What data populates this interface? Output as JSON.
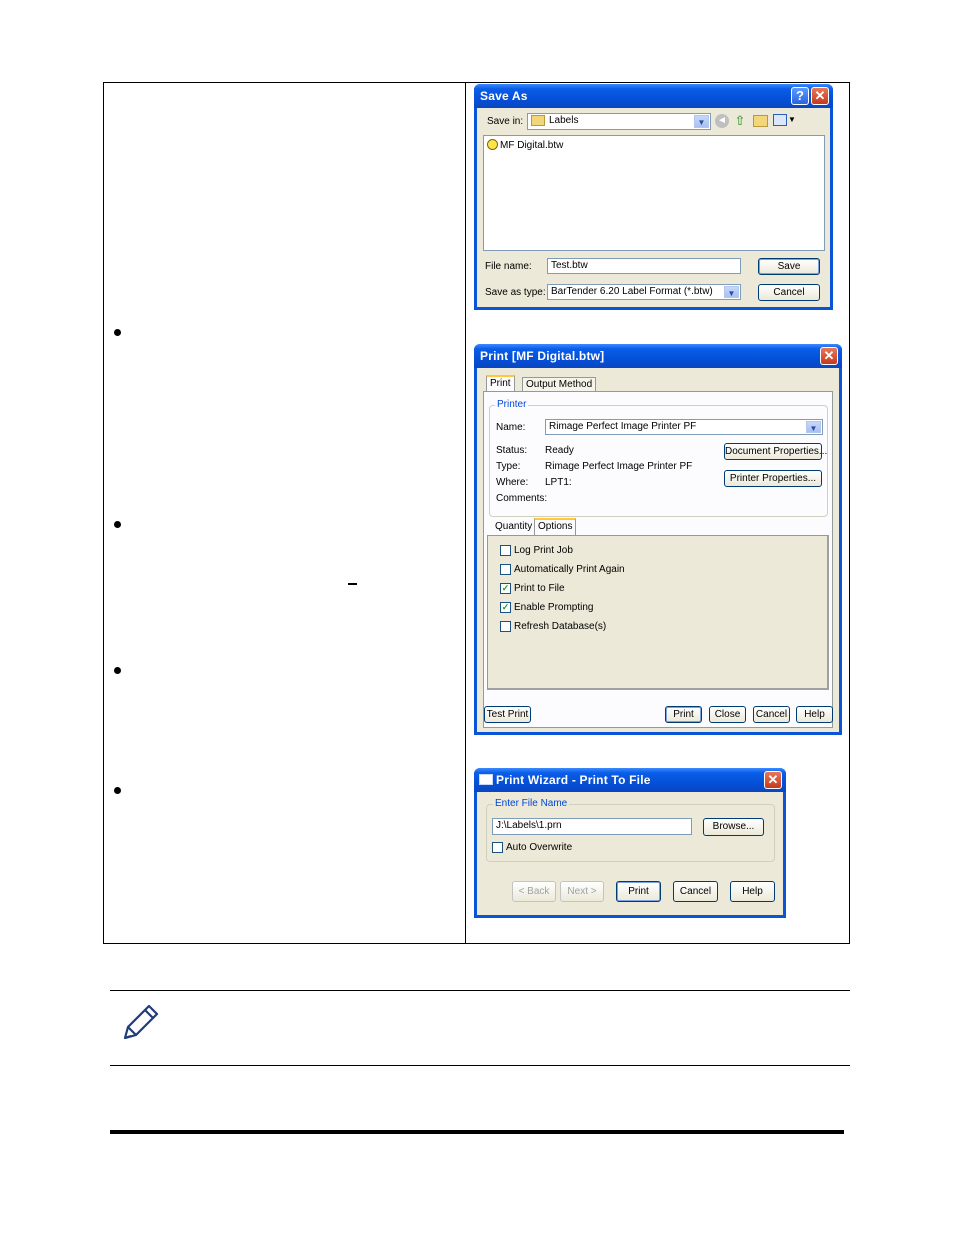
{
  "save_as": {
    "title": "Save As",
    "save_in_label": "Save in:",
    "save_in_value": "Labels",
    "file": "MF Digital.btw",
    "file_name_label": "File name:",
    "file_name_value": "Test.btw",
    "save_type_label": "Save as type:",
    "save_type_value": "BarTender 6.20 Label Format (*.btw)",
    "save_button": "Save",
    "cancel_button": "Cancel"
  },
  "print_dialog": {
    "title": "Print [MF Digital.btw]",
    "tabs": [
      "Print",
      "Output Method"
    ],
    "printer_group": "Printer",
    "name_label": "Name:",
    "name_value": "Rimage Perfect Image Printer PF",
    "status_label": "Status:",
    "status_value": "Ready",
    "type_label": "Type:",
    "type_value": "Rimage Perfect Image Printer PF",
    "where_label": "Where:",
    "where_value": "LPT1:",
    "comments_label": "Comments:",
    "doc_props_button": "Document Properties...",
    "printer_props_button": "Printer Properties...",
    "subtabs": [
      "Quantity",
      "Options"
    ],
    "options": [
      {
        "label": "Log Print Job",
        "checked": false
      },
      {
        "label": "Automatically Print Again",
        "checked": false
      },
      {
        "label": "Print to File",
        "checked": true
      },
      {
        "label": "Enable Prompting",
        "checked": true
      },
      {
        "label": "Refresh Database(s)",
        "checked": false
      }
    ],
    "test_print_button": "Test Print",
    "print_button": "Print",
    "close_button": "Close",
    "cancel_button": "Cancel",
    "help_button": "Help"
  },
  "wizard": {
    "title": "Print Wizard - Print To File",
    "group": "Enter File Name",
    "path_value": "J:\\Labels\\1.prn",
    "browse_button": "Browse...",
    "auto_overwrite": "Auto Overwrite",
    "back_button": "< Back",
    "next_button": "Next >",
    "print_button": "Print",
    "cancel_button": "Cancel",
    "help_button": "Help"
  },
  "icons": {
    "note": "pencil-icon",
    "check_color": "#21a121",
    "titlebar_color": "#0a54d7",
    "close_color": "#c53a1c"
  }
}
